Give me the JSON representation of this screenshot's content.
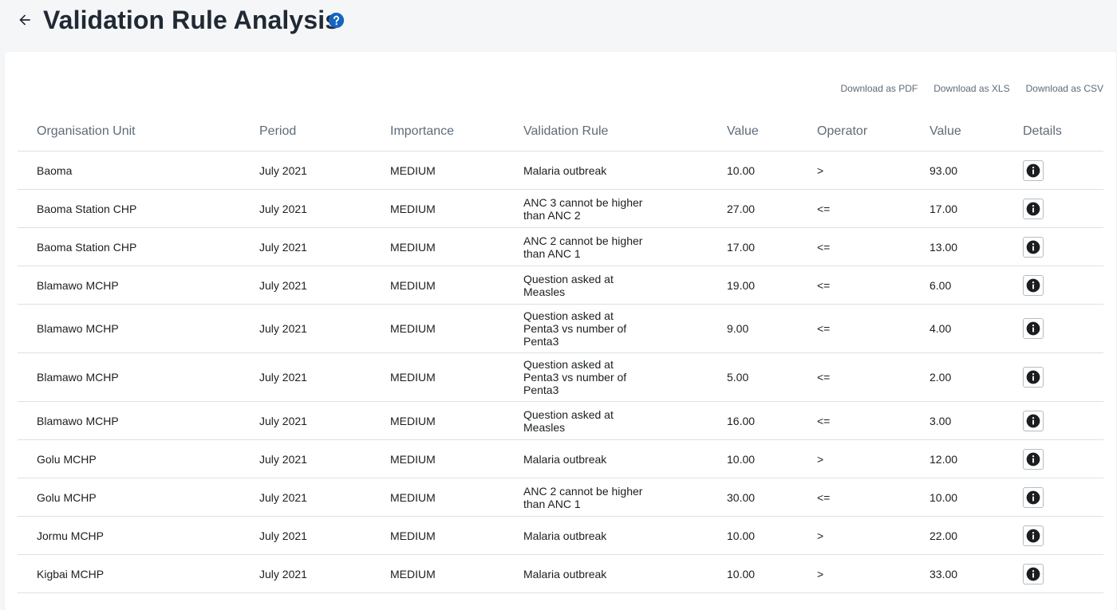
{
  "header": {
    "title": "Validation Rule Analysis"
  },
  "downloads": [
    {
      "label": "Download as PDF"
    },
    {
      "label": "Download as XLS"
    },
    {
      "label": "Download as CSV"
    }
  ],
  "table": {
    "columns": [
      "Organisation Unit",
      "Period",
      "Importance",
      "Validation Rule",
      "Value",
      "Operator",
      "Value",
      "Details"
    ],
    "rows": [
      {
        "org": "Baoma",
        "period": "July 2021",
        "importance": "MEDIUM",
        "rule": "Malaria outbreak",
        "left": "10.00",
        "op": ">",
        "right": "93.00"
      },
      {
        "org": "Baoma Station CHP",
        "period": "July 2021",
        "importance": "MEDIUM",
        "rule": "ANC 3 cannot be higher than ANC 2",
        "left": "27.00",
        "op": "<=",
        "right": "17.00"
      },
      {
        "org": "Baoma Station CHP",
        "period": "July 2021",
        "importance": "MEDIUM",
        "rule": "ANC 2 cannot be higher than ANC 1",
        "left": "17.00",
        "op": "<=",
        "right": "13.00"
      },
      {
        "org": "Blamawo MCHP",
        "period": "July 2021",
        "importance": "MEDIUM",
        "rule": "Question asked at Measles",
        "left": "19.00",
        "op": "<=",
        "right": "6.00"
      },
      {
        "org": "Blamawo MCHP",
        "period": "July 2021",
        "importance": "MEDIUM",
        "rule": "Question asked at Penta3 vs number of Penta3",
        "left": "9.00",
        "op": "<=",
        "right": "4.00"
      },
      {
        "org": "Blamawo MCHP",
        "period": "July 2021",
        "importance": "MEDIUM",
        "rule": "Question asked at Penta3 vs number of Penta3",
        "left": "5.00",
        "op": "<=",
        "right": "2.00"
      },
      {
        "org": "Blamawo MCHP",
        "period": "July 2021",
        "importance": "MEDIUM",
        "rule": "Question asked at Measles",
        "left": "16.00",
        "op": "<=",
        "right": "3.00"
      },
      {
        "org": "Golu MCHP",
        "period": "July 2021",
        "importance": "MEDIUM",
        "rule": "Malaria outbreak",
        "left": "10.00",
        "op": ">",
        "right": "12.00"
      },
      {
        "org": "Golu MCHP",
        "period": "July 2021",
        "importance": "MEDIUM",
        "rule": "ANC 2 cannot be higher than ANC 1",
        "left": "30.00",
        "op": "<=",
        "right": "10.00"
      },
      {
        "org": "Jormu MCHP",
        "period": "July 2021",
        "importance": "MEDIUM",
        "rule": "Malaria outbreak",
        "left": "10.00",
        "op": ">",
        "right": "22.00"
      },
      {
        "org": "Kigbai MCHP",
        "period": "July 2021",
        "importance": "MEDIUM",
        "rule": "Malaria outbreak",
        "left": "10.00",
        "op": ">",
        "right": "33.00"
      }
    ]
  },
  "icons": {
    "back": "arrow-left-icon",
    "help": "help-circle-icon",
    "info": "info-circle-icon"
  },
  "colors": {
    "help_icon": "#1565c0",
    "info_icon": "#1b1e21"
  }
}
